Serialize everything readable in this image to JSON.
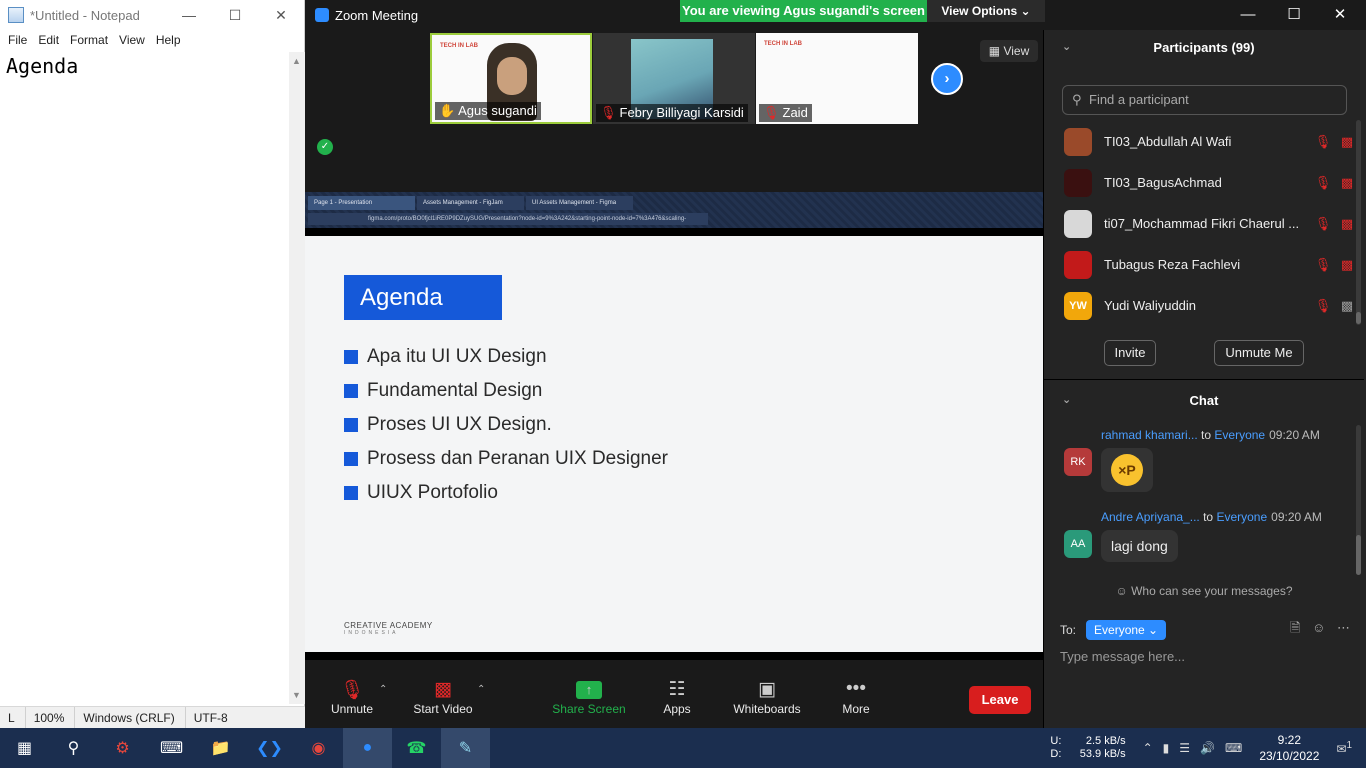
{
  "notepad": {
    "title": "*Untitled - Notepad",
    "menu": [
      "File",
      "Edit",
      "Format",
      "View",
      "Help"
    ],
    "content": "Agenda",
    "status": {
      "position": "L",
      "zoom": "100%",
      "line_ending": "Windows (CRLF)",
      "encoding": "UTF-8"
    }
  },
  "zoom": {
    "title": "Zoom Meeting",
    "viewing_banner": "You are viewing Agus sugandi's screen",
    "view_options": "View Options",
    "view_btn": "View",
    "participants_strip": [
      {
        "name": "Agus sugandi",
        "muted": false
      },
      {
        "name": "Febry Billiyagi Karsidi",
        "muted": true
      },
      {
        "name": "Zaid",
        "muted": true
      }
    ],
    "thumb_text": "TECH IN LAB",
    "shared": {
      "tabs": [
        "Page 1 - Presentation",
        "Assets Management - FigJam",
        "UI Assets Management - Figma"
      ],
      "url": "figma.com/proto/BO0fjcl1iRE0P9DZuySUG/Presentation?node-id=9%3A242&starting-point-node-id=7%3A476&scaling-",
      "slide_title": "Agenda",
      "items": [
        "Apa itu UI UX Design",
        "Fundamental Design",
        "Proses UI UX Design.",
        "Prosess dan Peranan UIX Designer",
        "UIUX Portofolio"
      ],
      "footer": "CREATIVE ACADEMY",
      "footer_sub": "INDONESIA"
    },
    "toolbar": {
      "unmute": "Unmute",
      "start_video": "Start Video",
      "share_screen": "Share Screen",
      "apps": "Apps",
      "whiteboards": "Whiteboards",
      "more": "More",
      "leave": "Leave"
    },
    "participants_panel": {
      "header": "Participants (99)",
      "search_placeholder": "Find a participant",
      "list": [
        {
          "name": "TI03_Abdullah Al Wafi",
          "avatar_color": "#9a4a2a",
          "video_off": true
        },
        {
          "name": "TI03_BagusAchmad",
          "avatar_color": "#3a1010",
          "video_off": true
        },
        {
          "name": "ti07_Mochammad Fikri Chaerul ...",
          "avatar_color": "#d8d8d8",
          "video_off": true
        },
        {
          "name": "Tubagus Reza Fachlevi",
          "avatar_color": "#c21a1a",
          "video_off": true
        },
        {
          "name": "Yudi Waliyuddin",
          "avatar_initials": "YW",
          "avatar_color": "#f2a70b",
          "video_off": false
        }
      ],
      "invite": "Invite",
      "unmute_me": "Unmute Me"
    },
    "chat": {
      "header": "Chat",
      "messages": [
        {
          "initials": "RK",
          "avatar_color": "#b53a3a",
          "sender": "rahmad khamari...",
          "to": "to",
          "recipient": "Everyone",
          "time": "09:20 AM",
          "text": ""
        },
        {
          "initials": "AA",
          "avatar_color": "#2a9a7a",
          "sender": "Andre Apriyana_...",
          "to": "to",
          "recipient": "Everyone",
          "time": "09:20 AM",
          "text": "lagi dong"
        }
      ],
      "who_can_see": "Who can see your messages?",
      "to_label": "To:",
      "to_value": "Everyone",
      "placeholder": "Type message here..."
    }
  },
  "taskbar": {
    "net_up_label": "U:",
    "net_down_label": "D:",
    "net_up": "2.5 kB/s",
    "net_down": "53.9 kB/s",
    "time": "9:22",
    "date": "23/10/2022",
    "notifications": "1"
  }
}
